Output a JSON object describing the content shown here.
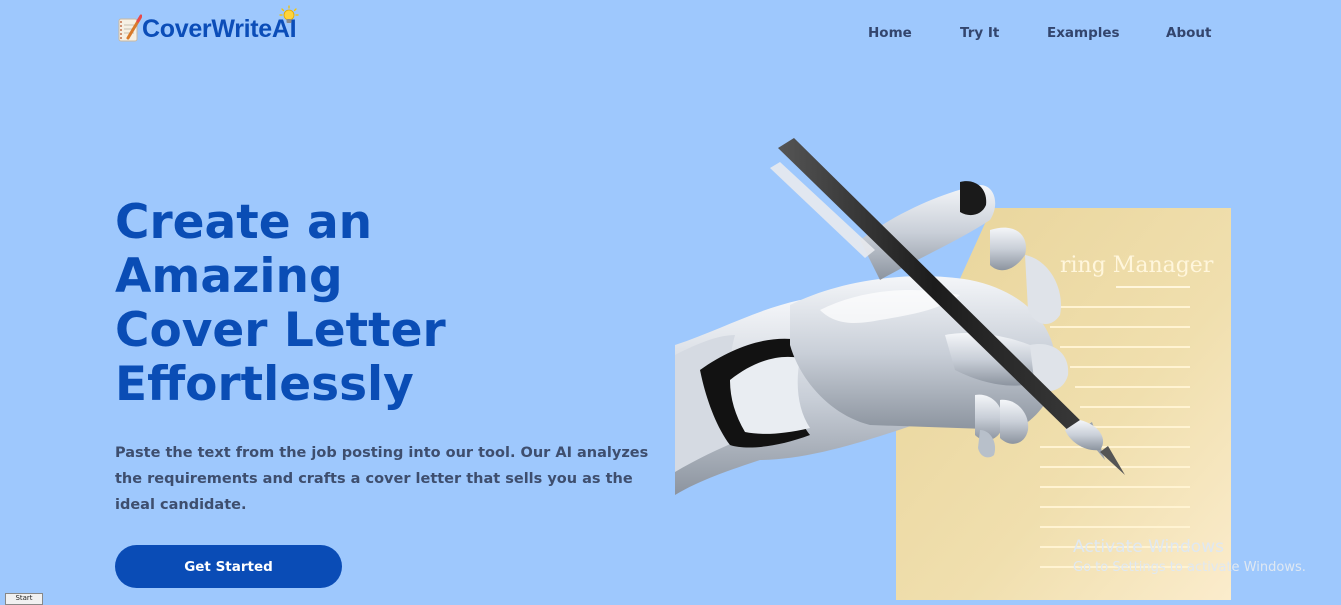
{
  "brand": {
    "name": "CoverWriteAI"
  },
  "nav": {
    "items": [
      {
        "label": "Home"
      },
      {
        "label": "Try It"
      },
      {
        "label": "Examples"
      },
      {
        "label": "About"
      }
    ]
  },
  "hero": {
    "title_lines": [
      "Create an",
      "Amazing",
      "Cover Letter",
      "Effortlessly"
    ],
    "description": "Paste the text from the job posting into our tool. Our AI analyzes the requirements and crafts a cover letter that sells you as the ideal candidate.",
    "cta_label": "Get Started",
    "paper_heading": "ring Manager"
  },
  "os_watermark": {
    "title": "Activate Windows",
    "subtitle": "Go to Settings to activate Windows."
  },
  "taskbar": {
    "start_label": "Start"
  },
  "colors": {
    "background": "#9ec8fd",
    "brand_blue": "#0a4db5",
    "nav_text": "#33456d",
    "body_text": "#3e4e6e",
    "button_bg": "#0a4cb6",
    "paper": "#efdca8"
  }
}
